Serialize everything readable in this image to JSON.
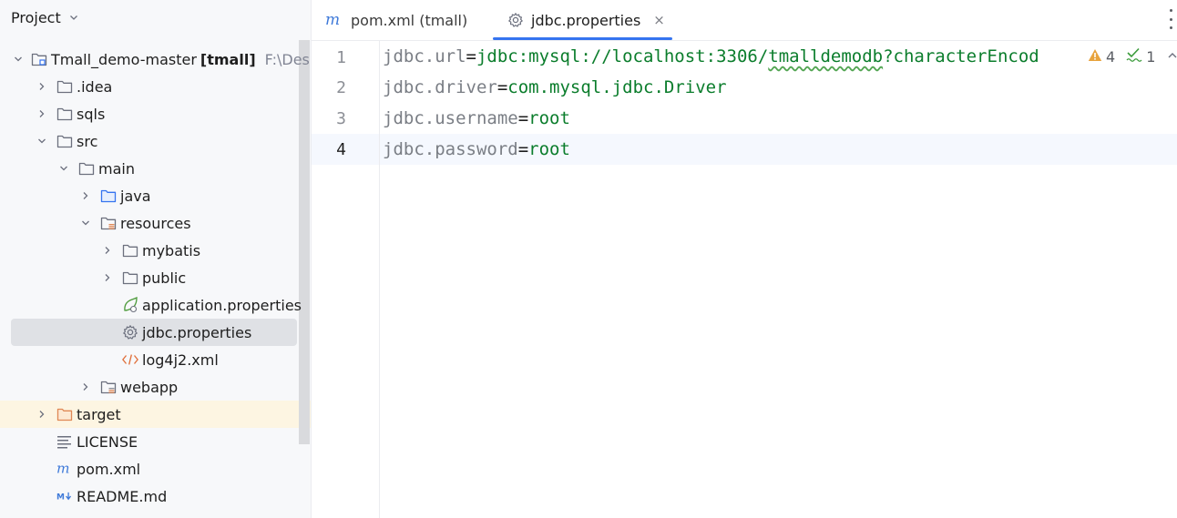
{
  "project_panel": {
    "title": "Project",
    "tree": [
      {
        "label": "Tmall_demo-master",
        "bold": "[tmall]",
        "path": "F:\\Desk",
        "icon": "module-folder-icon",
        "expanded": true
      },
      {
        "label": ".idea",
        "icon": "folder-icon",
        "expanded": false
      },
      {
        "label": "sqls",
        "icon": "folder-icon",
        "expanded": false
      },
      {
        "label": "src",
        "icon": "folder-icon",
        "expanded": true
      },
      {
        "label": "main",
        "icon": "folder-icon",
        "expanded": true
      },
      {
        "label": "java",
        "icon": "source-folder-icon",
        "expanded": false
      },
      {
        "label": "resources",
        "icon": "resources-folder-icon",
        "expanded": true
      },
      {
        "label": "mybatis",
        "icon": "folder-icon",
        "expanded": false
      },
      {
        "label": "public",
        "icon": "folder-icon",
        "expanded": false
      },
      {
        "label": "application.properties",
        "icon": "spring-config-icon"
      },
      {
        "label": "jdbc.properties",
        "icon": "gear-icon",
        "selected": true
      },
      {
        "label": "log4j2.xml",
        "icon": "xml-icon"
      },
      {
        "label": "webapp",
        "icon": "web-folder-icon",
        "expanded": false
      },
      {
        "label": "target",
        "icon": "excluded-folder-icon",
        "expanded": false
      },
      {
        "label": "LICENSE",
        "icon": "text-file-icon"
      },
      {
        "label": "pom.xml",
        "icon": "maven-icon"
      },
      {
        "label": "README.md",
        "icon": "markdown-icon"
      }
    ]
  },
  "editor": {
    "tabs": [
      {
        "label": "pom.xml (tmall)",
        "icon": "maven-icon",
        "active": false
      },
      {
        "label": "jdbc.properties",
        "icon": "gear-icon",
        "active": true,
        "close": "×"
      }
    ],
    "lines": [
      {
        "no": "1",
        "key": "jdbc.url",
        "eq": "=",
        "value": "jdbc:mysql://localhost:3306/",
        "value_wavy": "tmalldemodb",
        "value_rest": "?characterEncod"
      },
      {
        "no": "2",
        "key": "jdbc.driver",
        "eq": "=",
        "value": "com.mysql.jdbc.Driver"
      },
      {
        "no": "3",
        "key": "jdbc.username",
        "eq": "=",
        "value": "root"
      },
      {
        "no": "4",
        "key": "jdbc.password",
        "eq": "=",
        "value": "root"
      }
    ],
    "current_line": "4",
    "inspections": {
      "warnings": "4",
      "typos": "1"
    }
  },
  "colors": {
    "accent": "#3574f0",
    "value_green": "#0b7d2c",
    "key_gray": "#7a7e85",
    "warning": "#e8a33d"
  }
}
